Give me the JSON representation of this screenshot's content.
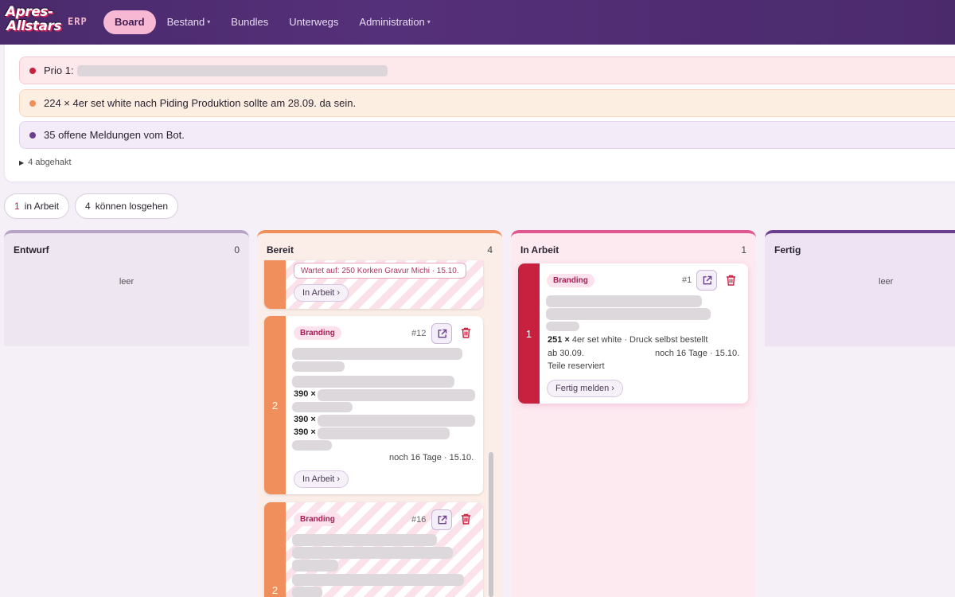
{
  "brand": {
    "logo_line1": "Apres-",
    "logo_line2": "Allstars",
    "app": "ERP"
  },
  "nav": [
    {
      "label": "Board",
      "active": true,
      "dropdown": false
    },
    {
      "label": "Bestand",
      "active": false,
      "dropdown": true
    },
    {
      "label": "Bundles",
      "active": false,
      "dropdown": false
    },
    {
      "label": "Unterwegs",
      "active": false,
      "dropdown": false
    },
    {
      "label": "Administration",
      "active": false,
      "dropdown": true
    }
  ],
  "notes": {
    "items": [
      {
        "text": "Prio 1:",
        "color": "#c7213f"
      },
      {
        "text": "224 × 4er set white nach Piding Produktion sollte am 28.09. da sein.",
        "color": "#f08f5b"
      },
      {
        "text": "35 offene Meldungen vom Bot.",
        "color": "#6b3e8e"
      }
    ],
    "checked_toggle": "4 abgehakt"
  },
  "chips": [
    {
      "count": "1",
      "label": "in Arbeit"
    },
    {
      "count": "4",
      "label": "können losgehen"
    }
  ],
  "columns": {
    "entwurf": {
      "title": "Entwurf",
      "count": "0",
      "empty": "leer"
    },
    "bereit": {
      "title": "Bereit",
      "count": "4"
    },
    "arbeit": {
      "title": "In Arbeit",
      "count": "1"
    },
    "fertig": {
      "title": "Fertig",
      "empty": "leer"
    }
  },
  "cards": {
    "bereit_top": {
      "wait_label": "Wartet auf: 250 Korken Gravur Michi · 15.10.",
      "action": "In Arbeit ›"
    },
    "bereit_12": {
      "priority": "2",
      "tag": "Branding",
      "number": "#12",
      "qty1": "390 ×",
      "qty2": "390 ×",
      "qty3": "390 ×",
      "due": "noch 16 Tage · 15.10.",
      "action": "In Arbeit ›"
    },
    "bereit_16": {
      "priority": "2",
      "tag": "Branding",
      "number": "#16"
    },
    "arbeit_1": {
      "priority": "1",
      "tag": "Branding",
      "number": "#1",
      "line1_qty": "251 ×",
      "line1_rest": "4er set white · Druck selbst bestellt",
      "since": "ab 30.09.",
      "due": "noch 16 Tage · 15.10.",
      "status": "Teile reserviert",
      "action": "Fertig melden ›"
    }
  },
  "colors": {
    "accent": "#f7b8d3",
    "topbar": "#4a2a6b",
    "prio1": "#c7213f",
    "prio2": "#f08f5b"
  }
}
